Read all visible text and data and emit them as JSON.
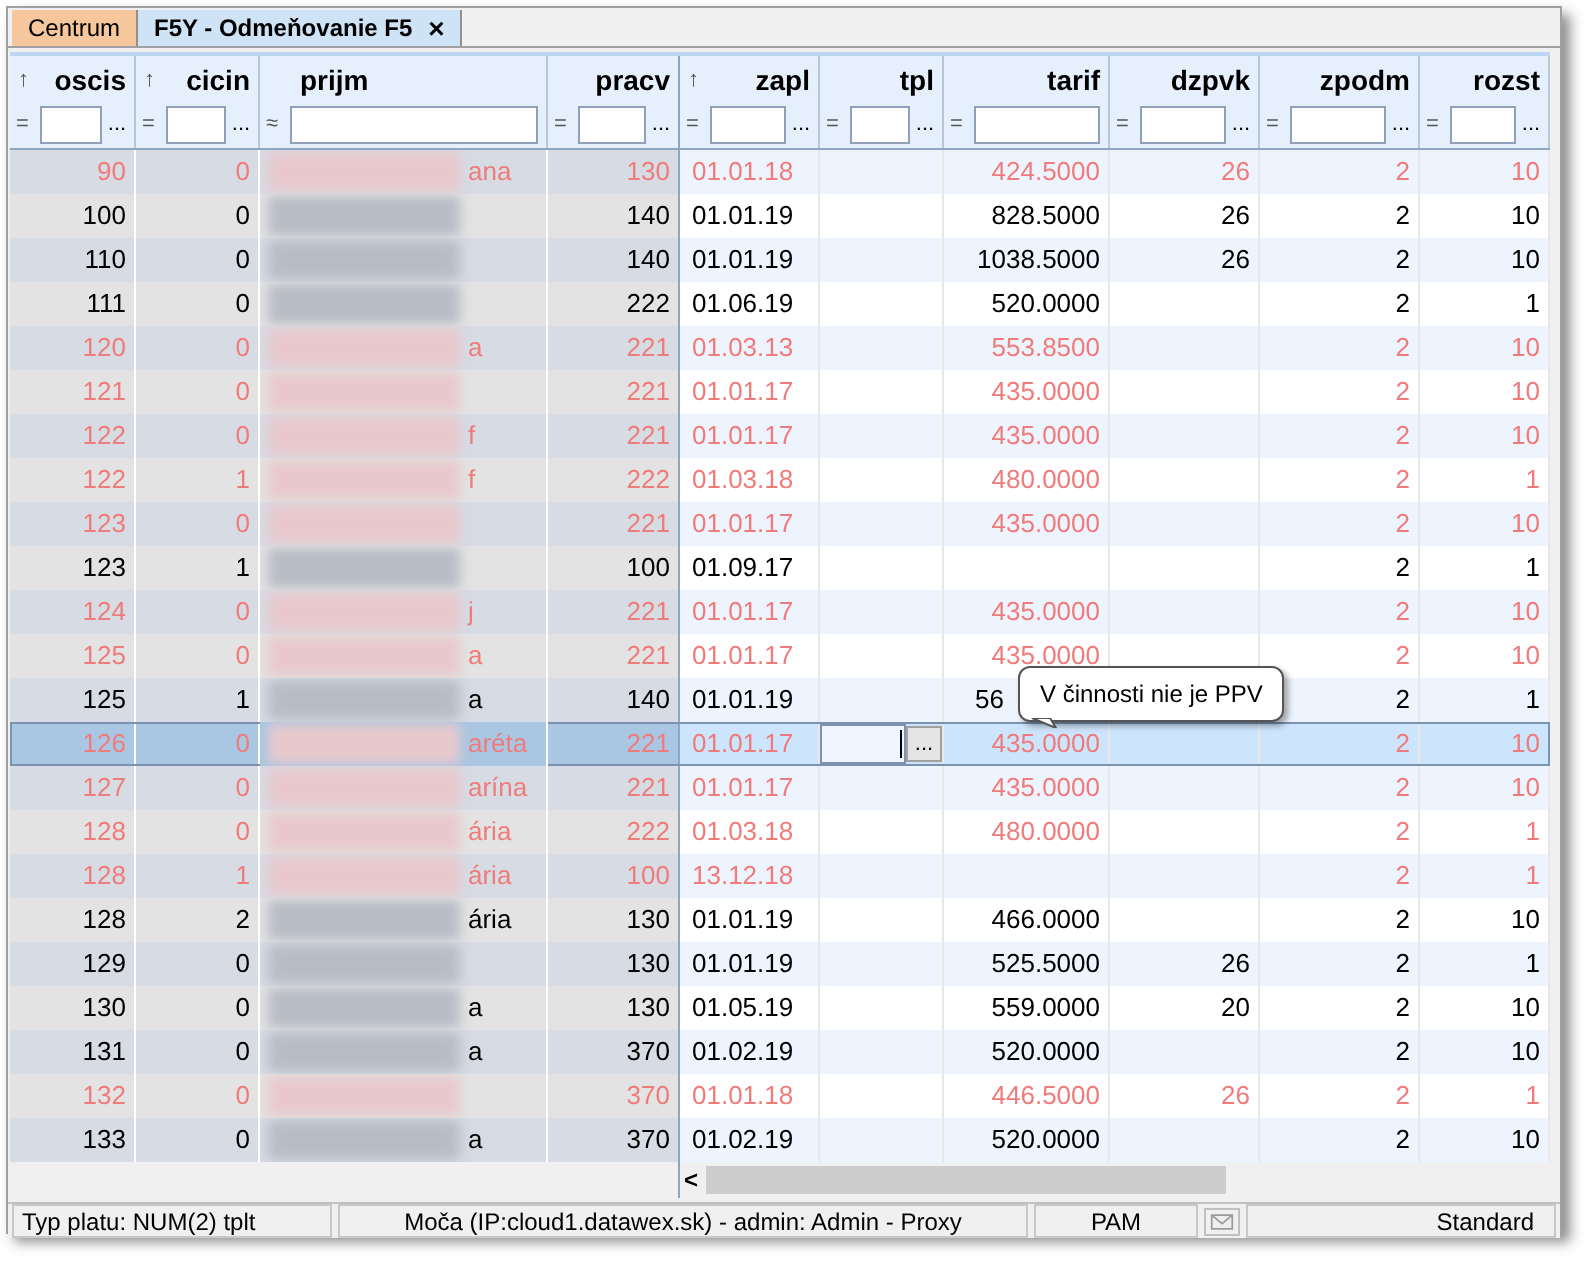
{
  "tabs": [
    {
      "label": "Centrum",
      "selected": false,
      "closable": false
    },
    {
      "label": "F5Y - Odmeňovanie F5",
      "selected": true,
      "closable": true,
      "close_glyph": "×"
    }
  ],
  "columns": [
    {
      "label": "oscis",
      "sort_mark": "↑",
      "operator": "=",
      "more": "..."
    },
    {
      "label": "cicin",
      "sort_mark": "↑",
      "operator": "=",
      "more": "..."
    },
    {
      "label": "prijm",
      "operator": "≈"
    },
    {
      "label": "pracv",
      "operator": "=",
      "more": "..."
    },
    {
      "label": "zapl",
      "sort_mark": "↑",
      "operator": "=",
      "more": "..."
    },
    {
      "label": "tpl",
      "operator": "=",
      "more": "..."
    },
    {
      "label": "tarif",
      "operator": "="
    },
    {
      "label": "dzpvk",
      "operator": "=",
      "more": "..."
    },
    {
      "label": "zpodm",
      "operator": "=",
      "more": "..."
    },
    {
      "label": "rozst",
      "operator": "=",
      "more": "..."
    }
  ],
  "rows": [
    {
      "inactive": true,
      "selected": false,
      "cells": [
        "90",
        "0",
        "ana",
        "130",
        "01.01.18",
        "",
        "424.5000",
        "26",
        "2",
        "10"
      ]
    },
    {
      "inactive": false,
      "selected": false,
      "cells": [
        "100",
        "0",
        "",
        "140",
        "01.01.19",
        "",
        "828.5000",
        "26",
        "2",
        "10"
      ]
    },
    {
      "inactive": false,
      "selected": false,
      "cells": [
        "110",
        "0",
        "",
        "140",
        "01.01.19",
        "",
        "1038.5000",
        "26",
        "2",
        "10"
      ]
    },
    {
      "inactive": false,
      "selected": false,
      "cells": [
        "111",
        "0",
        "",
        "222",
        "01.06.19",
        "",
        "520.0000",
        "",
        "2",
        "1"
      ]
    },
    {
      "inactive": true,
      "selected": false,
      "cells": [
        "120",
        "0",
        "a",
        "221",
        "01.03.13",
        "",
        "553.8500",
        "",
        "2",
        "10"
      ]
    },
    {
      "inactive": true,
      "selected": false,
      "cells": [
        "121",
        "0",
        "",
        "221",
        "01.01.17",
        "",
        "435.0000",
        "",
        "2",
        "10"
      ]
    },
    {
      "inactive": true,
      "selected": false,
      "cells": [
        "122",
        "0",
        "f",
        "221",
        "01.01.17",
        "",
        "435.0000",
        "",
        "2",
        "10"
      ]
    },
    {
      "inactive": true,
      "selected": false,
      "cells": [
        "122",
        "1",
        "f",
        "222",
        "01.03.18",
        "",
        "480.0000",
        "",
        "2",
        "1"
      ]
    },
    {
      "inactive": true,
      "selected": false,
      "cells": [
        "123",
        "0",
        "",
        "221",
        "01.01.17",
        "",
        "435.0000",
        "",
        "2",
        "10"
      ]
    },
    {
      "inactive": false,
      "selected": false,
      "cells": [
        "123",
        "1",
        "",
        "100",
        "01.09.17",
        "",
        "",
        "",
        "2",
        "1"
      ]
    },
    {
      "inactive": true,
      "selected": false,
      "cells": [
        "124",
        "0",
        "j",
        "221",
        "01.01.17",
        "",
        "435.0000",
        "",
        "2",
        "10"
      ]
    },
    {
      "inactive": true,
      "selected": false,
      "cells": [
        "125",
        "0",
        "a",
        "221",
        "01.01.17",
        "",
        "435.0000",
        "",
        "2",
        "10"
      ]
    },
    {
      "inactive": false,
      "selected": false,
      "tarif_covered": true,
      "cells": [
        "125",
        "1",
        "a",
        "140",
        "01.01.19",
        "",
        "56",
        "",
        "2",
        "1"
      ]
    },
    {
      "inactive": true,
      "selected": true,
      "editing": true,
      "editor_button": "...",
      "cells": [
        "126",
        "0",
        "aréta",
        "221",
        "01.01.17",
        "",
        "435.0000",
        "",
        "2",
        "10"
      ]
    },
    {
      "inactive": true,
      "selected": false,
      "cells": [
        "127",
        "0",
        "arína",
        "221",
        "01.01.17",
        "",
        "435.0000",
        "",
        "2",
        "10"
      ]
    },
    {
      "inactive": true,
      "selected": false,
      "cells": [
        "128",
        "0",
        "ária",
        "222",
        "01.03.18",
        "",
        "480.0000",
        "",
        "2",
        "1"
      ]
    },
    {
      "inactive": true,
      "selected": false,
      "cells": [
        "128",
        "1",
        "ária",
        "100",
        "13.12.18",
        "",
        "",
        "",
        "2",
        "1"
      ]
    },
    {
      "inactive": false,
      "selected": false,
      "cells": [
        "128",
        "2",
        "ária",
        "130",
        "01.01.19",
        "",
        "466.0000",
        "",
        "2",
        "10"
      ]
    },
    {
      "inactive": false,
      "selected": false,
      "cells": [
        "129",
        "0",
        "",
        "130",
        "01.01.19",
        "",
        "525.5000",
        "26",
        "2",
        "1"
      ]
    },
    {
      "inactive": false,
      "selected": false,
      "cells": [
        "130",
        "0",
        "a",
        "130",
        "01.05.19",
        "",
        "559.0000",
        "20",
        "2",
        "10"
      ]
    },
    {
      "inactive": false,
      "selected": false,
      "cells": [
        "131",
        "0",
        "a",
        "370",
        "01.02.19",
        "",
        "520.0000",
        "",
        "2",
        "10"
      ]
    },
    {
      "inactive": true,
      "selected": false,
      "cells": [
        "132",
        "0",
        "",
        "370",
        "01.01.18",
        "",
        "446.5000",
        "26",
        "2",
        "1"
      ]
    },
    {
      "inactive": false,
      "selected": false,
      "cells": [
        "133",
        "0",
        "a",
        "370",
        "01.02.19",
        "",
        "520.0000",
        "",
        "2",
        "10"
      ]
    }
  ],
  "tooltip": {
    "text": "V činnosti nie je PPV"
  },
  "scrollbar": {
    "left_glyph": "<"
  },
  "status_bar": {
    "items": [
      {
        "kind": "text",
        "text": "Typ platu: NUM(2) tplt"
      },
      {
        "kind": "text",
        "text": "Moča (IP:cloud1.datawex.sk) - admin: Admin - Proxy"
      },
      {
        "kind": "text",
        "text": "PAM"
      },
      {
        "kind": "mail"
      },
      {
        "kind": "text",
        "text": "Standard"
      }
    ]
  }
}
